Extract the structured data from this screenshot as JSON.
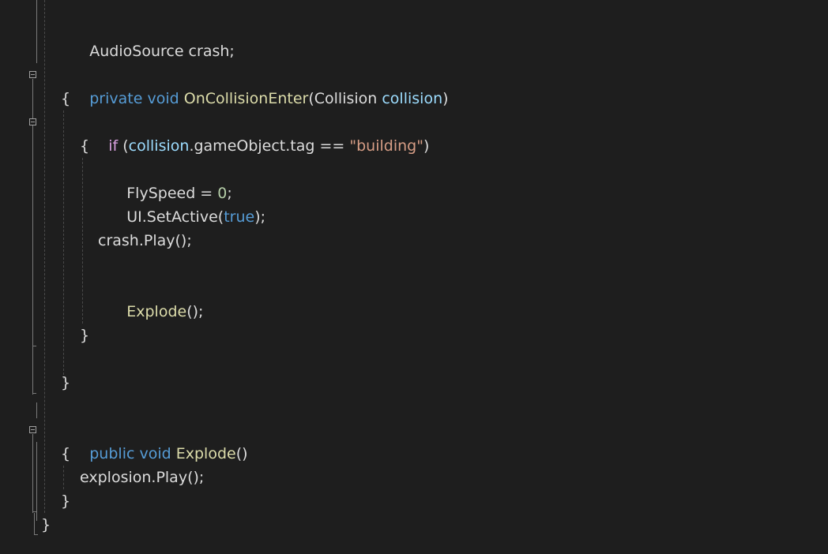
{
  "code_lines": {
    "l0": {
      "t1": "AudioSource",
      "t2": " crash;"
    },
    "l2": {
      "t1": "private",
      "t2": " ",
      "t3": "void",
      "t4": " ",
      "t5": "OnCollisionEnter",
      "t6": "(Collision ",
      "t7": "collision",
      "t8": ")"
    },
    "l3": {
      "t1": "{"
    },
    "l4": {
      "t1": "if",
      "t2": " (",
      "t3": "collision",
      "t4": ".gameObject.tag == ",
      "t5": "\"building\"",
      "t6": ")"
    },
    "l5": {
      "t1": "{"
    },
    "l6": {
      "t1": "FlySpeed = ",
      "t2": "0",
      "t3": ";"
    },
    "l7": {
      "t1": "UI.SetActive(",
      "t2": "true",
      "t3": ");"
    },
    "l9": {
      "t1": "crash.Play();"
    },
    "l11": {
      "t1": "Explode",
      "t2": "();"
    },
    "l13": {
      "t1": "}"
    },
    "l15": {
      "t1": "}"
    },
    "l17": {
      "t1": "public",
      "t2": " ",
      "t3": "void",
      "t4": " ",
      "t5": "Explode",
      "t6": "()"
    },
    "l18": {
      "t1": "{"
    },
    "l19": {
      "t1": "explosion.Play();"
    },
    "l20": {
      "t1": "}"
    },
    "l21": {
      "t1": "}"
    }
  },
  "colors": {
    "background": "#1e1e1e",
    "keyword": "#569cd6",
    "control": "#d8a0df",
    "method": "#dcdcaa",
    "parameter": "#9cdcfe",
    "string": "#d69d85",
    "number": "#b5cea8",
    "text": "#dcdcdc"
  },
  "icons": [
    "collapse-region-icon"
  ]
}
